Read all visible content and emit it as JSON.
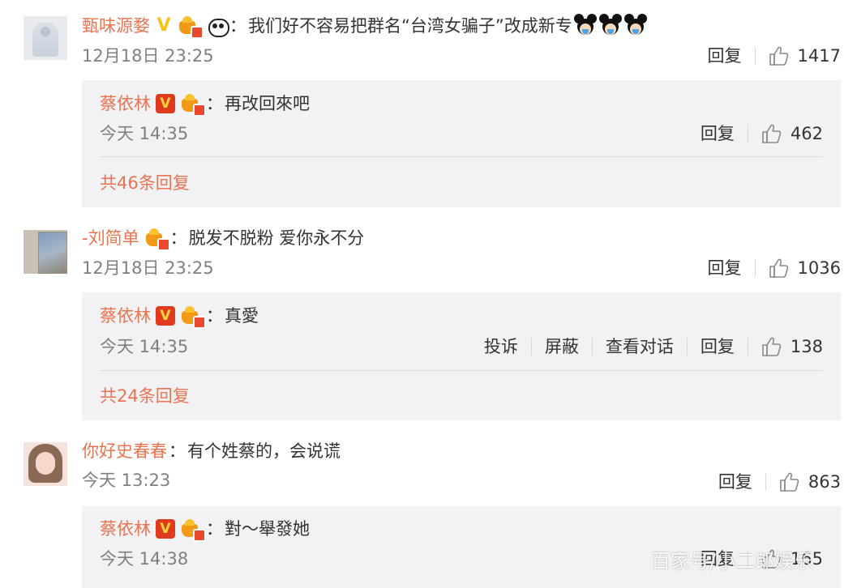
{
  "comments": [
    {
      "user": "甄味源婺",
      "text": "我们好不容易把群名“台湾女骗子”改成新专",
      "time": "12月18日 23:25",
      "reply_label": "回复",
      "likes": "1417",
      "icons": [
        "gold-v-badge",
        "crown-badge",
        "panda-emoji",
        "mickey-emoji",
        "mickey-emoji",
        "mickey-emoji"
      ],
      "reply": {
        "user": "蔡依林",
        "text": "再改回來吧",
        "time": "今天 14:35",
        "reply_label": "回复",
        "likes": "462",
        "more": "共46条回复"
      }
    },
    {
      "user": "-刘简单",
      "text": "脱发不脱粉 爱你永不分",
      "time": "12月18日 23:25",
      "reply_label": "回复",
      "likes": "1036",
      "reply": {
        "user": "蔡依林",
        "text": "真愛",
        "time": "今天 14:35",
        "report_label": "投诉",
        "block_label": "屏蔽",
        "view_label": "查看对话",
        "reply_label": "回复",
        "likes": "138",
        "more": "共24条回复"
      }
    },
    {
      "user": "你好史春春",
      "text": "有个姓蔡的，会说谎",
      "time": "今天 13:23",
      "reply_label": "回复",
      "likes": "863",
      "reply": {
        "user": "蔡依林",
        "text": "對～舉發她",
        "time": "今天 14:38",
        "reply_label": "回复",
        "likes": "165"
      }
    }
  ],
  "colon": "：",
  "watermark": "百家号/小二郎娱乐",
  "colors": {
    "username": "#eb7350",
    "meta": "#808080",
    "reply_bg": "#f2f2f5",
    "text": "#333333"
  }
}
